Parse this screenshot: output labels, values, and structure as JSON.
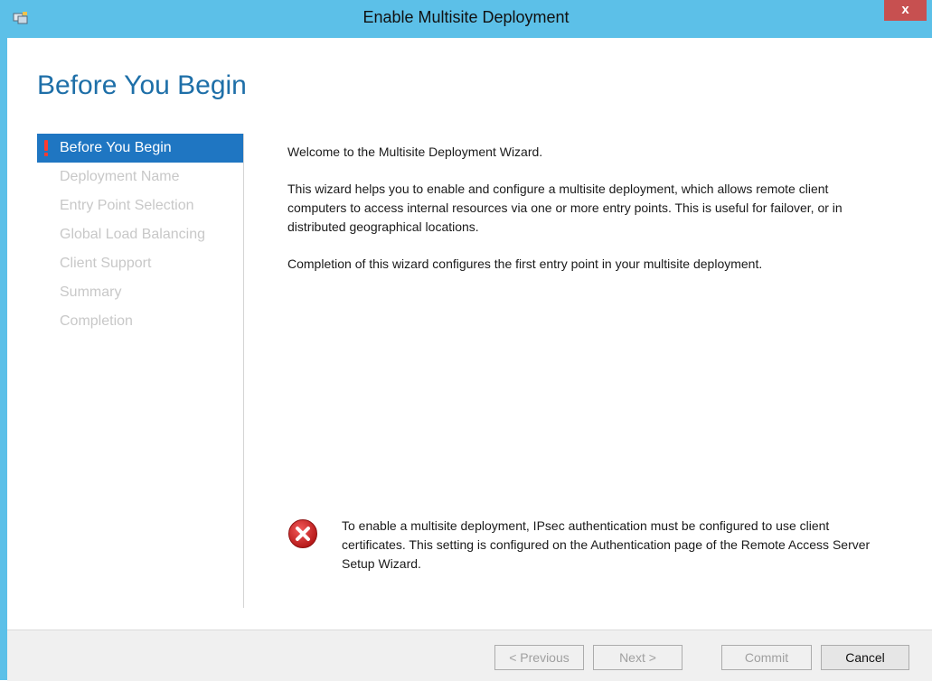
{
  "window": {
    "title": "Enable Multisite Deployment",
    "close_label": "x",
    "accent_color": "#5cc0e8"
  },
  "page": {
    "title": "Before You Begin"
  },
  "nav": {
    "items": [
      {
        "label": "Before You Begin",
        "active": true,
        "status": "warning"
      },
      {
        "label": "Deployment Name",
        "active": false
      },
      {
        "label": "Entry Point Selection",
        "active": false
      },
      {
        "label": "Global Load Balancing",
        "active": false
      },
      {
        "label": "Client Support",
        "active": false
      },
      {
        "label": "Summary",
        "active": false
      },
      {
        "label": "Completion",
        "active": false
      }
    ]
  },
  "content": {
    "welcome": "Welcome to the Multisite Deployment Wizard.",
    "description": "This wizard helps you to enable and configure a multisite deployment, which allows remote client computers to access internal resources via one or more entry points. This is useful for failover, or in distributed geographical locations.",
    "completion_note": "Completion of this wizard configures the first entry point in your multisite deployment."
  },
  "error": {
    "icon": "error-icon",
    "message": "To enable a multisite deployment, IPsec authentication must be configured to use client certificates. This setting is configured on the Authentication page of the Remote Access Server Setup Wizard."
  },
  "footer": {
    "previous_label": "< Previous",
    "next_label": "Next >",
    "commit_label": "Commit",
    "cancel_label": "Cancel"
  }
}
